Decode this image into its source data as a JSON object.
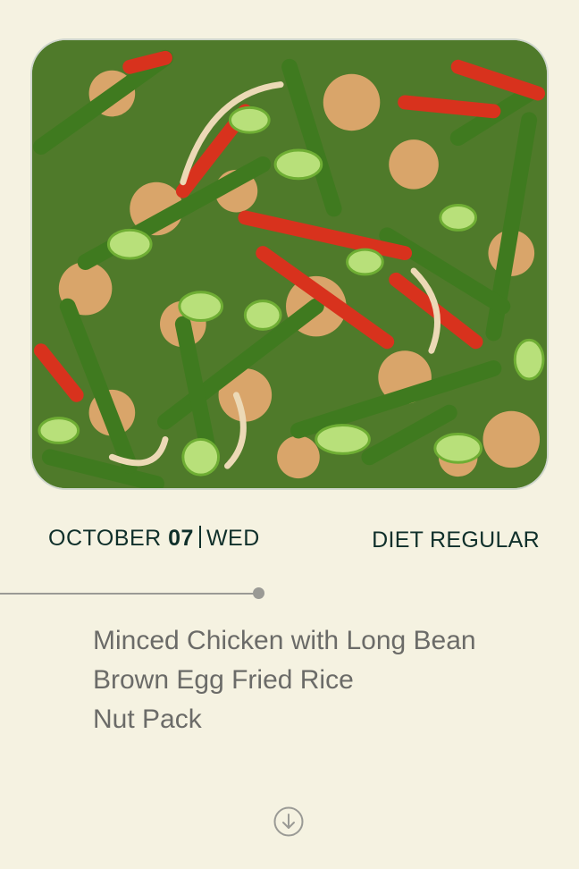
{
  "hero": {
    "image_alt": "Stir-fried minced chicken with green beans, red peppers, onions and scallions"
  },
  "date": {
    "month": "OCTOBER",
    "day": "07",
    "weekday": "WED"
  },
  "diet": {
    "label": "DIET REGULAR"
  },
  "menu": {
    "items": [
      "Minced Chicken with Long Bean",
      "Brown Egg Fried Rice",
      "Nut Pack"
    ]
  },
  "icons": {
    "scroll": "arrow-down-circle-icon"
  },
  "colors": {
    "background": "#f5f2e1",
    "heading": "#0f2f2a",
    "menu_text": "#6b6b68",
    "timeline": "#9a9a95"
  }
}
